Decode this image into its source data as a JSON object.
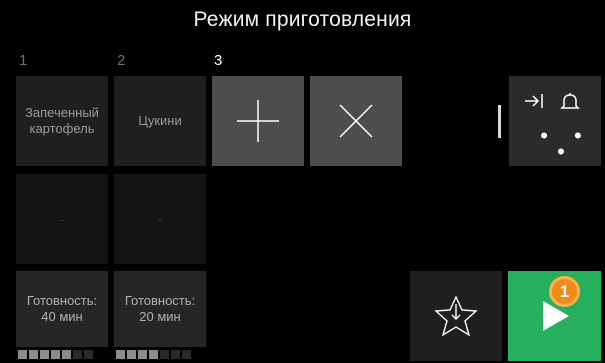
{
  "header": {
    "title": "Режим приготовления"
  },
  "steps": [
    {
      "number": "1",
      "dish": "Запеченный картофель",
      "empty": "-",
      "ready_text": "Готовность:",
      "ready_time": "40 мин",
      "progress": 5,
      "progress_total": 7
    },
    {
      "number": "2",
      "dish": "Цукини",
      "empty": "-",
      "ready_text": "Готовность:",
      "ready_time": "20 мин",
      "progress": 4,
      "progress_total": 7
    },
    {
      "number": "3"
    }
  ],
  "actions": {
    "add_icon": "plus-icon",
    "delete_icon": "x-icon",
    "options_icons": [
      "skip-to-end-icon",
      "bell-icon",
      "more-dots-icon"
    ],
    "dots": "• • •",
    "favorite_icon": "star-with-arrow-icon",
    "start_icon": "play-icon"
  },
  "badge": {
    "label": "1"
  },
  "colors": {
    "accent_green": "#26b05e",
    "badge_orange": "#f28a1b",
    "background": "#000000"
  }
}
